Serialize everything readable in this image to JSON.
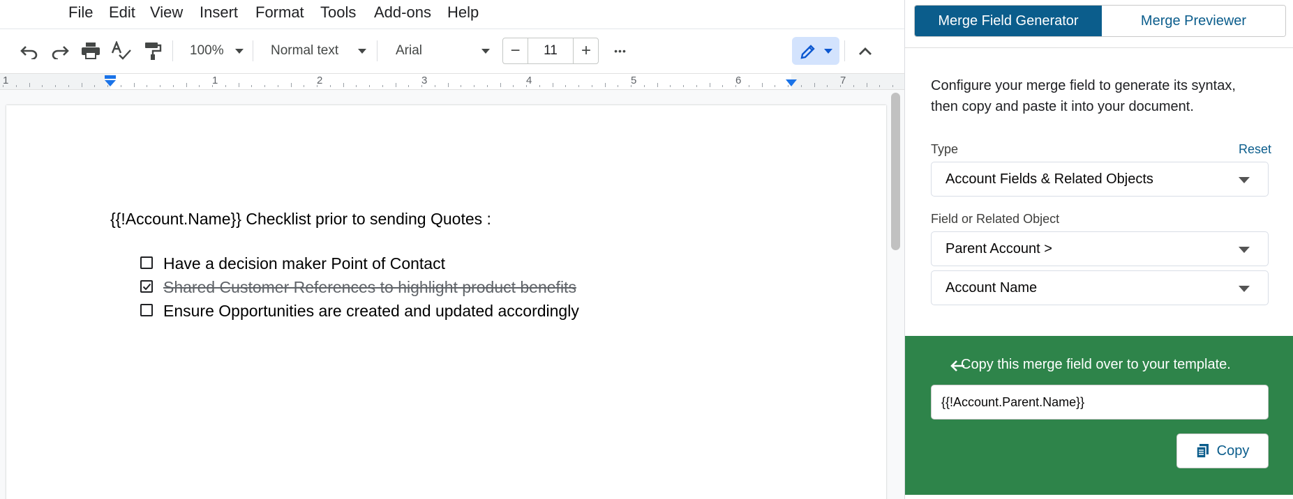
{
  "menubar": {
    "items": [
      "File",
      "Edit",
      "View",
      "Insert",
      "Format",
      "Tools",
      "Add-ons",
      "Help"
    ]
  },
  "toolbar": {
    "zoom": "100%",
    "style": "Normal text",
    "font": "Arial",
    "font_size": "11",
    "minus": "−",
    "plus": "+",
    "more": "•••",
    "icons": [
      "undo-icon",
      "redo-icon",
      "print-icon",
      "spellcheck-icon",
      "paint-format-icon",
      "pencil-icon",
      "collapse-chevron-icon"
    ]
  },
  "ruler": {
    "numbers": [
      "1",
      "1",
      "2",
      "3",
      "4",
      "5",
      "6",
      "7"
    ]
  },
  "document": {
    "heading": "{{!Account.Name}} Checklist prior to sending Quotes :",
    "checklist": [
      {
        "text": "Have a decision maker Point of Contact",
        "checked": false
      },
      {
        "text": "Shared Customer References to highlight product benefits",
        "checked": true
      },
      {
        "text": "Ensure Opportunities are created and updated accordingly",
        "checked": false
      }
    ]
  },
  "panel": {
    "tabs": [
      {
        "label": "Merge Field Generator",
        "active": true
      },
      {
        "label": "Merge Previewer",
        "active": false
      }
    ],
    "intro_line1": "Configure your merge field to generate its syntax,",
    "intro_line2": "then copy and paste it into your document.",
    "type_label": "Type",
    "reset_label": "Reset",
    "type_value": "Account Fields & Related Objects",
    "field_label": "Field or Related Object",
    "field_value": "Parent Account >",
    "subfield_value": "Account Name",
    "copy_instruction": "Copy this merge field over to your template.",
    "merge_output": "{{!Account.Parent.Name}}",
    "copy_label": "Copy"
  },
  "colors": {
    "brand_blue": "#0b5d8c",
    "success_green": "#2e844a",
    "docs_accent": "#1a73e8"
  }
}
